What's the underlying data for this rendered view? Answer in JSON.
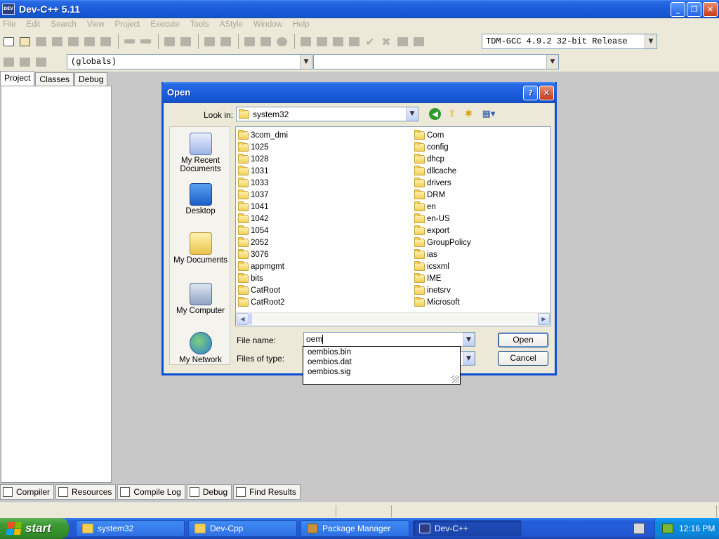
{
  "window": {
    "title": "Dev-C++ 5.11",
    "icon_text": "DEV"
  },
  "menu": [
    "File",
    "Edit",
    "Search",
    "View",
    "Project",
    "Execute",
    "Tools",
    "AStyle",
    "Window",
    "Help"
  ],
  "toolbar": {
    "compiler_select": "TDM-GCC 4.9.2 32-bit Release",
    "scope_select": "(globals)",
    "member_select": ""
  },
  "left_tabs": [
    "Project",
    "Classes",
    "Debug"
  ],
  "bottom_tabs": [
    "Compiler",
    "Resources",
    "Compile Log",
    "Debug",
    "Find Results"
  ],
  "dialog": {
    "title": "Open",
    "help_button": "?",
    "close_button": "✕",
    "look_in_label": "Look in:",
    "look_in_value": "system32",
    "places": [
      "My Recent Documents",
      "Desktop",
      "My Documents",
      "My Computer",
      "My Network"
    ],
    "folders_col1": [
      "3com_dmi",
      "1025",
      "1028",
      "1031",
      "1033",
      "1037",
      "1041",
      "1042",
      "1054",
      "2052",
      "3076",
      "appmgmt",
      "bits",
      "CatRoot",
      "CatRoot2"
    ],
    "folders_col2": [
      "Com",
      "config",
      "dhcp",
      "dllcache",
      "drivers",
      "DRM",
      "en",
      "en-US",
      "export",
      "GroupPolicy",
      "ias",
      "icsxml",
      "IME",
      "inetsrv",
      "Microsoft"
    ],
    "file_name_label": "File name:",
    "file_name_value": "oem",
    "files_of_type_label": "Files of type:",
    "open_button": "Open",
    "cancel_button": "Cancel",
    "autocomplete": [
      "oembios.bin",
      "oembios.dat",
      "oembios.sig"
    ]
  },
  "taskbar": {
    "start_label": "start",
    "tasks": [
      "system32",
      "Dev-Cpp",
      "Package Manager",
      "Dev-C++"
    ],
    "clock": "12:16 PM"
  }
}
